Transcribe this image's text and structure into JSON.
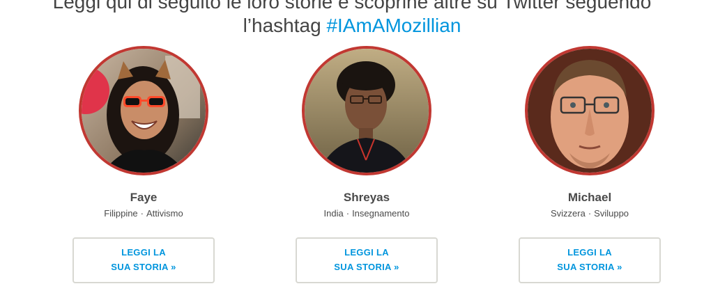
{
  "intro": {
    "line1": "Leggi qui di seguito le loro storie e scoprine altre su Twitter seguendo",
    "line2_prefix": "l’hashtag ",
    "hashtag": "#IAmAMozillian"
  },
  "colors": {
    "accent": "#0095dd",
    "avatar_ring": "#c13832",
    "text": "#4a4a4a",
    "button_border": "#d8d8d2"
  },
  "people": [
    {
      "name": "Faye",
      "country": "Filippine",
      "separator": "·",
      "area": "Attivismo",
      "button_line1": "LEGGI LA",
      "button_line2": "SUA STORIA  »"
    },
    {
      "name": "Shreyas",
      "country": "India",
      "separator": "·",
      "area": "Insegnamento",
      "button_line1": "LEGGI LA",
      "button_line2": "SUA STORIA  »"
    },
    {
      "name": "Michael",
      "country": "Svizzera",
      "separator": "·",
      "area": "Sviluppo",
      "button_line1": "LEGGI LA",
      "button_line2": "SUA STORIA  »"
    }
  ]
}
